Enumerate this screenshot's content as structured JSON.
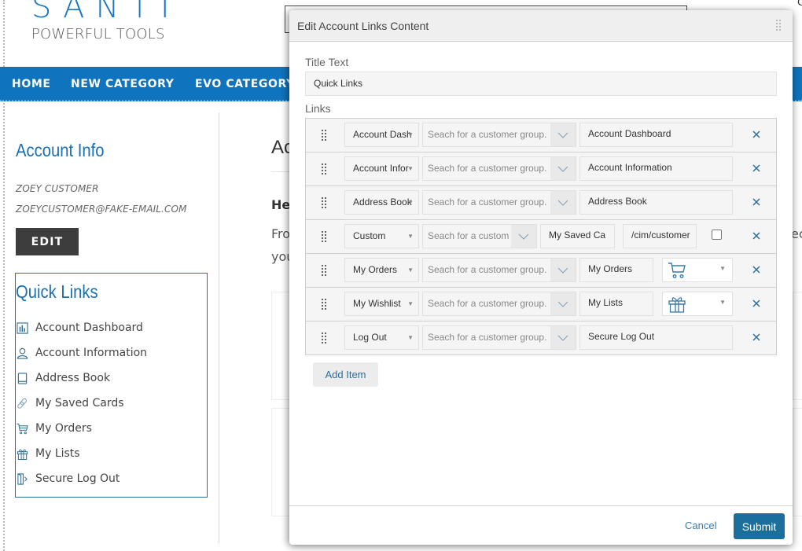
{
  "site": {
    "brand": "SANTI",
    "tagline": "POWERFUL TOOLS",
    "top_right_char": "C"
  },
  "nav": {
    "items": [
      "HOME",
      "NEW CATEGORY",
      "EVO CATEGORY"
    ]
  },
  "sidebar": {
    "account_title": "Account Info",
    "customer_name": "ZOEY CUSTOMER",
    "customer_email": "ZOEYCUSTOMER@FAKE-EMAIL.COM",
    "edit_label": "EDIT",
    "quick_links_title": "Quick Links",
    "quick_links": [
      {
        "label": "Account Dashboard",
        "icon": "dashboard-icon"
      },
      {
        "label": "Account Information",
        "icon": "user-icon"
      },
      {
        "label": "Address Book",
        "icon": "book-icon"
      },
      {
        "label": "My Saved Cards",
        "icon": "link-icon"
      },
      {
        "label": "My Orders",
        "icon": "cart-icon"
      },
      {
        "label": "My Lists",
        "icon": "gift-icon"
      },
      {
        "label": "Secure Log Out",
        "icon": "logout-icon"
      }
    ]
  },
  "background_main": {
    "heading_partial": "Ac",
    "bold_partial": "He",
    "text_line1_partial": "Fro",
    "text_line2_partial": "you",
    "right_partial": "ec"
  },
  "modal": {
    "title": "Edit Account Links Content",
    "title_text_label": "Title Text",
    "title_text_value": "Quick Links",
    "links_label": "Links",
    "group_placeholder": "Seach for a customer group.",
    "group_placeholder_short": "Seach for a custom",
    "links": [
      {
        "type": "Account Dash",
        "label": "Account Dashboard"
      },
      {
        "type": "Account Infor",
        "label": "Account Information"
      },
      {
        "type": "Address Book",
        "label": "Address Book"
      },
      {
        "type": "Custom",
        "label": "My Saved Ca",
        "url": "/cim/customer",
        "new_tab": false
      },
      {
        "type": "My Orders",
        "label": "My Orders",
        "icon": "cart-icon"
      },
      {
        "type": "My Wishlist",
        "label": "My Lists",
        "icon": "gift-icon"
      },
      {
        "type": "Log Out",
        "label": "Secure Log Out"
      }
    ],
    "add_item_label": "Add Item",
    "cancel_label": "Cancel",
    "submit_label": "Submit"
  },
  "colors": {
    "brand_blue": "#0f74bd",
    "heading_blue": "#1a6fae",
    "submit_blue": "#1b6f9c",
    "edit_button": "#3d3d3d"
  }
}
